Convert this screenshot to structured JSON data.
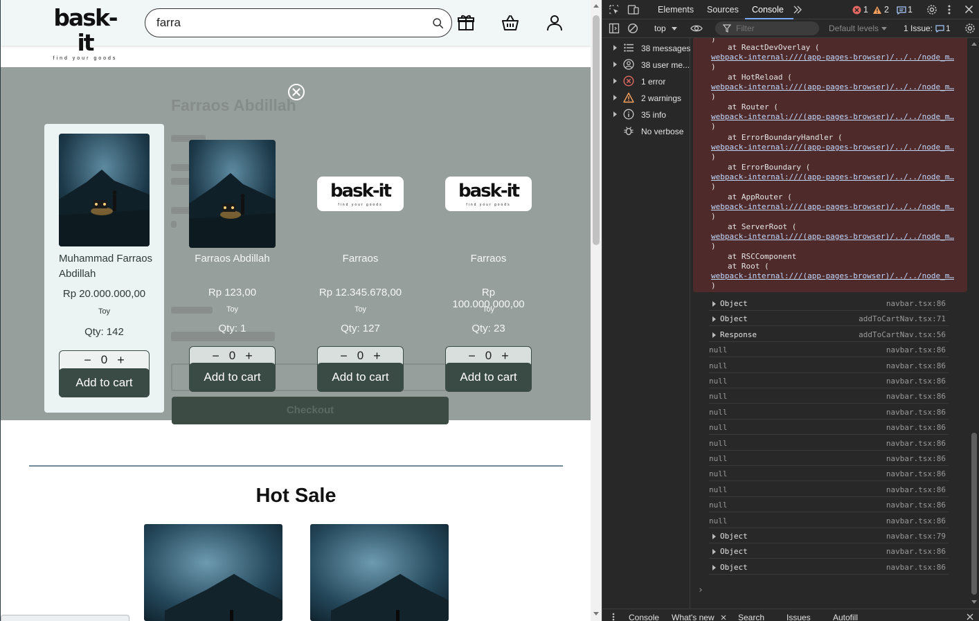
{
  "site": {
    "logo": {
      "wordmark": "bask-it",
      "tagline": "find your goods"
    },
    "search": {
      "value": "farra"
    },
    "nav_icons": [
      "gift-icon",
      "basket-icon",
      "user-icon"
    ],
    "checkout_label": "Checkout",
    "ghost_title": "Farraos Abdillah",
    "selected": {
      "name": "Muhammad Farraos Abdillah",
      "price": "Rp 20.000.000,00",
      "category": "Toy",
      "qty": "Qty: 142",
      "stepper_value": "0",
      "add_label": "Add to cart"
    },
    "results": [
      {
        "name": "Farraos Abdillah",
        "price": "Rp 123,00",
        "category": "Toy",
        "qty": "Qty: 1",
        "stepper_value": "0",
        "add_label": "Add to cart",
        "image": "night-car"
      },
      {
        "name": "Farraos",
        "price": "Rp 12.345.678,00",
        "category": "Toy",
        "qty": "Qty: 127",
        "stepper_value": "0",
        "add_label": "Add to cart",
        "image": "logo"
      },
      {
        "name": "Farraos",
        "price": "Rp 100.000.000,00",
        "category": "Toy",
        "qty": "Qty: 23",
        "stepper_value": "0",
        "add_label": "Add to cart",
        "image": "logo"
      }
    ],
    "hot_sale_title": "Hot Sale"
  },
  "devtools": {
    "tabs": [
      "Elements",
      "Sources",
      "Console"
    ],
    "active_tab": "Console",
    "badges": {
      "errors": "1",
      "warnings": "2",
      "issues": "1"
    },
    "toolbar": {
      "context": "top",
      "filter_placeholder": "Filter",
      "levels": "Default levels",
      "issues": "1 Issue:",
      "issues_count": "1"
    },
    "sidebar": [
      {
        "label": "38 messages",
        "icon": "list-icon"
      },
      {
        "label": "38 user me...",
        "icon": "user-icon"
      },
      {
        "label": "1 error",
        "icon": "error-icon"
      },
      {
        "label": "2 warnings",
        "icon": "warning-icon"
      },
      {
        "label": "35 info",
        "icon": "info-icon"
      },
      {
        "label": "No verbose",
        "icon": "bug-icon"
      }
    ],
    "stack": [
      {
        "at": "at ReactDevOverlay (",
        "link": "webpack-internal:///(app-pages-browser)/../../node_m…",
        "close": ")"
      },
      {
        "at": "at HotReload (",
        "link": "webpack-internal:///(app-pages-browser)/../../node_m…",
        "close": ")"
      },
      {
        "at": "at Router (",
        "link": "webpack-internal:///(app-pages-browser)/../../node_m…",
        "close": ")"
      },
      {
        "at": "at ErrorBoundaryHandler (",
        "link": "webpack-internal:///(app-pages-browser)/../../node_m…",
        "close": ")"
      },
      {
        "at": "at ErrorBoundary (",
        "link": "webpack-internal:///(app-pages-browser)/../../node_m…",
        "close": ")"
      },
      {
        "at": "at AppRouter (",
        "link": "webpack-internal:///(app-pages-browser)/../../node_m…",
        "close": ")"
      },
      {
        "at": "at ServerRoot (",
        "link": "webpack-internal:///(app-pages-browser)/../../node_m…",
        "close": ")"
      }
    ],
    "stack_tail": {
      "line1": "at RSCComponent",
      "line2": "at Root (",
      "link": "webpack-internal:///(app-pages-browser)/../../node_m…",
      "close": ")"
    },
    "logs": [
      {
        "msg": "Object",
        "src": "navbar.tsx:86",
        "expandable": true
      },
      {
        "msg": "Object",
        "src": "addToCartNav.tsx:71",
        "expandable": true
      },
      {
        "msg": "Response",
        "src": "addToCartNav.tsx:56",
        "expandable": true
      },
      {
        "msg": "null",
        "src": "navbar.tsx:86",
        "expandable": false
      },
      {
        "msg": "null",
        "src": "navbar.tsx:86",
        "expandable": false
      },
      {
        "msg": "null",
        "src": "navbar.tsx:86",
        "expandable": false
      },
      {
        "msg": "null",
        "src": "navbar.tsx:86",
        "expandable": false
      },
      {
        "msg": "null",
        "src": "navbar.tsx:86",
        "expandable": false
      },
      {
        "msg": "null",
        "src": "navbar.tsx:86",
        "expandable": false
      },
      {
        "msg": "null",
        "src": "navbar.tsx:86",
        "expandable": false
      },
      {
        "msg": "null",
        "src": "navbar.tsx:86",
        "expandable": false
      },
      {
        "msg": "null",
        "src": "navbar.tsx:86",
        "expandable": false
      },
      {
        "msg": "null",
        "src": "navbar.tsx:86",
        "expandable": false
      },
      {
        "msg": "null",
        "src": "navbar.tsx:86",
        "expandable": false
      },
      {
        "msg": "null",
        "src": "navbar.tsx:86",
        "expandable": false
      },
      {
        "msg": "Object",
        "src": "navbar.tsx:79",
        "expandable": true
      },
      {
        "msg": "Object",
        "src": "navbar.tsx:86",
        "expandable": true
      },
      {
        "msg": "Object",
        "src": "navbar.tsx:86",
        "expandable": true
      }
    ],
    "prompt": "›",
    "drawer_tabs": [
      "Console",
      "What's new",
      "Search",
      "Issues",
      "Autofill"
    ]
  },
  "colors": {
    "brand_dark": "#3a4a44",
    "overlay": "#979f9d",
    "error_bg": "#4e2a2a",
    "error_red": "#e46962",
    "warning_orange": "#f9a15c",
    "link_blue": "#c2d9ff",
    "accent_blue": "#7cacf8"
  }
}
